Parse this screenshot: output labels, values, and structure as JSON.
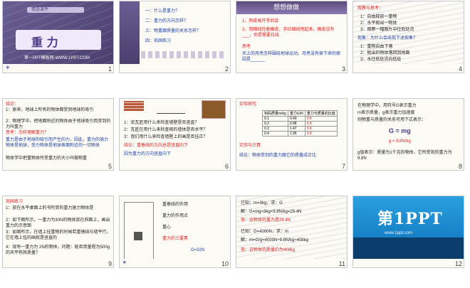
{
  "slides": [
    {
      "num": "1",
      "title": "重 力",
      "banner": "精品课件",
      "footer": "第一PPT模板网-WWW.1PPT.COM"
    },
    {
      "num": "2",
      "items": [
        "一：什么是重力？",
        "二：重力的方向怎样？",
        "三：物重跟质量的关系怎样？",
        "四：巩固练习"
      ]
    },
    {
      "num": "3",
      "heading": "想想做做",
      "lines": [
        "1，熟皮高开手后会",
        "2，用细线拴着橡皮，手拉细线甩起来，橡皮没有___，但是需要拉线",
        "思考",
        "天上的月亮怎样围绕地球运动，月亮没有掉下来的原因是______"
      ]
    },
    {
      "num": "4",
      "heading": "观察与思考：",
      "lines": [
        "1：自由释放一重物",
        "2：水平抛出一物体",
        "3：观察一幅图片中往低处流",
        "现象：为什么会出现下述现象？",
        "1：重物自由下落",
        "2：抛出的物体落回到地面",
        "3：水往低处流向低处"
      ]
    },
    {
      "num": "5",
      "lines": [
        "结论：",
        "1：原来，地球上所有的物体都受到地球的吸引",
        "2：物理学中，把地面附近的物体由于地球吸引而受到的力叫重力",
        "思考：怎样理解重力？",
        "重力是由于地球的吸引而产生的力，因此，重力的施力物体是地球，受力物体是地球表面附近的一切物体",
        "物体学中把重物体所受重力的大小叫做物重"
      ]
    },
    {
      "num": "6",
      "lines": [
        "1：泥瓦匠用什么来检查墙壁是否竖直？",
        "2：瓦匠在用什么来检查砌的墙体是否水平？",
        "3：我们用什么来检查墙壁上的画是否挂正？",
        "结论：重垂线的方向总是竖直向下",
        "因为重力的方向竖直向下"
      ]
    },
    {
      "num": "7",
      "lines": [
        "实验探究",
        "钩码质量m/kg",
        "重力G/N",
        "重力与质量的比值",
        "实验与计算",
        "结论：物体受到的重力跟它的质量成正比"
      ],
      "table": [
        [
          "0.1",
          "0.49",
          "9.8"
        ],
        [
          "0.2",
          "0.98",
          "9.8"
        ],
        [
          "0.3",
          "1.47",
          "9.8"
        ],
        [
          "0.4",
          "1.96",
          "9.8"
        ]
      ]
    },
    {
      "num": "8",
      "lines": [
        "在物理学中，用符号G表示重力",
        "m表示质量，g表示重力加速度",
        "则物重与质量的关系可用下式表示：",
        "G = mg",
        "g = 9.8N/kg",
        "g值表示：质量为1千克的物体，它所受到的重力为9.8N"
      ]
    },
    {
      "num": "9",
      "lines": [
        "巩固练习",
        "1：放在水平桌面上的书所受的重力施力物体是",
        "2：如下图所示，一重力为30N的物体放在斜面上，画出重力的示意图",
        "3：如图所示，在墙上挂重物的时候若重锤线与墙平行，它在墙上挂的画就是竖直的",
        "4：现有一重力为 2N的物体，问题：能否用量程为500g的天平称其质量？"
      ]
    },
    {
      "num": "10",
      "lines": [
        "重垂线的作用",
        "重力的作用点",
        "重心",
        "重力的三要素",
        "G=32N"
      ]
    },
    {
      "num": "11",
      "lines": [
        "已知：m=3kg，求：G",
        "解：G=mg=3kg×9.8N/kg=29.4N",
        "答：这物体的重力是29.4N",
        "已知：G=4000N，求：m",
        "解：m=G/g=4000N÷9.8N/kg≈408kg",
        "答：这物体的质量约为408kg"
      ]
    },
    {
      "num": "12",
      "brand": "第1PPT",
      "sub": "www.1ppt.com"
    }
  ],
  "colors": {
    "accent": "#7b5aa6",
    "red": "#d22222",
    "blue": "#1c3fa8",
    "band": "#5a4a7c"
  }
}
